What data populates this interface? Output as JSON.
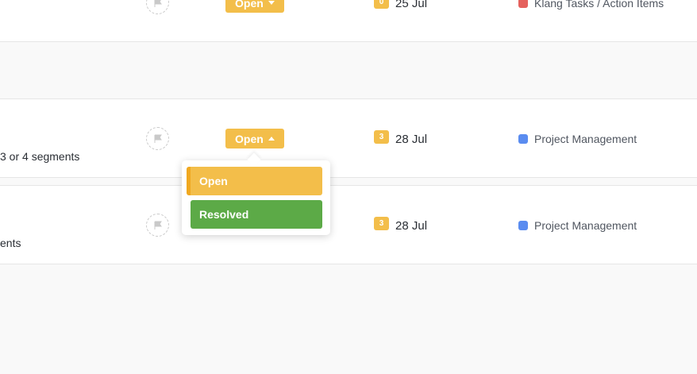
{
  "rows": {
    "top": {
      "status": "Open",
      "priority": "0",
      "date": "25 Jul",
      "list": {
        "label": "Klang Tasks / Action Items",
        "color": "#e5615d"
      }
    },
    "mid": {
      "task_fragment": "3 or 4 segments",
      "status": "Open",
      "priority": "3",
      "date": "28 Jul",
      "list": {
        "label": "Project Management",
        "color": "#5a8cf0"
      }
    },
    "bot": {
      "task_fragment": "ents",
      "priority": "3",
      "date": "28 Jul",
      "list": {
        "label": "Project Management",
        "color": "#5a8cf0"
      }
    }
  },
  "dropdown": {
    "options": [
      {
        "label": "Open",
        "color": "#f3be4a"
      },
      {
        "label": "Resolved",
        "color": "#5caa47"
      }
    ]
  },
  "icons": {
    "flag": "flag-icon",
    "caret_down": "caret-down-icon",
    "caret_up": "caret-up-icon"
  }
}
